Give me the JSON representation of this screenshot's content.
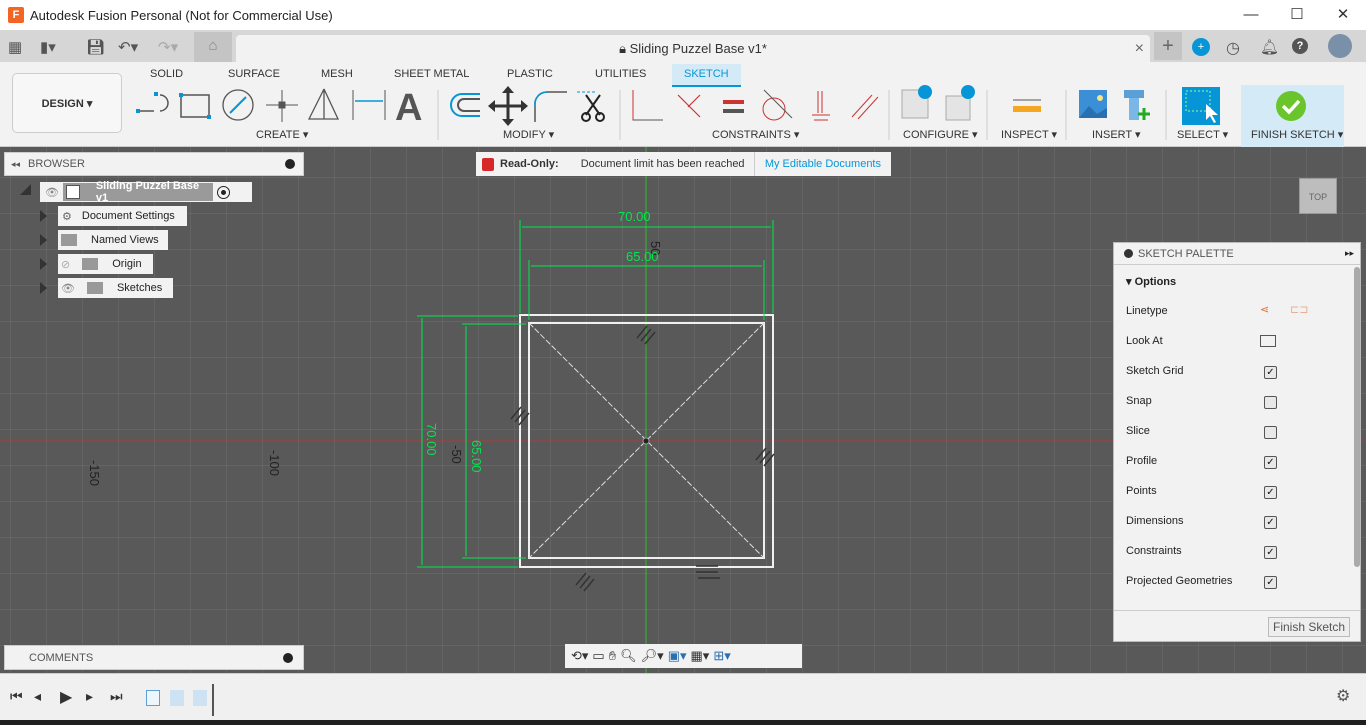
{
  "window": {
    "title": "Autodesk Fusion Personal (Not for Commercial Use)",
    "app_icon": "F",
    "minimize": "—",
    "maximize": "☐",
    "close": "✕"
  },
  "document_tab": {
    "title": "Sliding Puzzel Base v1*",
    "close": "×"
  },
  "ribbon": {
    "workspace": "DESIGN",
    "tabs": [
      "SOLID",
      "SURFACE",
      "MESH",
      "SHEET METAL",
      "PLASTIC",
      "UTILITIES",
      "SKETCH"
    ],
    "active_tab": "SKETCH",
    "groups": [
      "CREATE",
      "MODIFY",
      "CONSTRAINTS",
      "CONFIGURE",
      "INSPECT",
      "INSERT",
      "SELECT",
      "FINISH SKETCH"
    ],
    "create_text_tool": "A",
    "accent": "#0696d7"
  },
  "browser": {
    "title": "BROWSER",
    "root": "Sliding Puzzel Base v1",
    "items": [
      "Document Settings",
      "Named Views",
      "Origin",
      "Sketches"
    ]
  },
  "readonly": {
    "label": "Read-Only:",
    "message": "Document limit has been reached",
    "link": "My Editable Documents"
  },
  "viewcube": {
    "face": "TOP"
  },
  "sketch": {
    "dims": {
      "outer_width": "70.00",
      "inner_width": "65.00",
      "outer_height": "70.00",
      "inner_height": "65.00"
    },
    "axis_labels": {
      "x1": "-150",
      "x2": "-100",
      "y1": "-50",
      "y2": "50"
    },
    "line_color": "#00e64d"
  },
  "palette": {
    "title": "SKETCH PALETTE",
    "section": "Options",
    "linetype": "Linetype",
    "look_at": "Look At",
    "options": [
      {
        "label": "Sketch Grid",
        "checked": true
      },
      {
        "label": "Snap",
        "checked": false
      },
      {
        "label": "Slice",
        "checked": false
      },
      {
        "label": "Profile",
        "checked": true
      },
      {
        "label": "Points",
        "checked": true
      },
      {
        "label": "Dimensions",
        "checked": true
      },
      {
        "label": "Constraints",
        "checked": true
      },
      {
        "label": "Projected Geometries",
        "checked": true
      }
    ],
    "finish": "Finish Sketch"
  },
  "comments": {
    "title": "COMMENTS"
  }
}
